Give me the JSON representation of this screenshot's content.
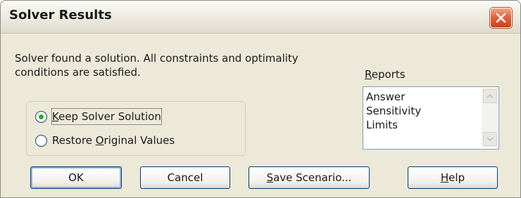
{
  "window": {
    "title": "Solver Results"
  },
  "message": {
    "line1": "Solver found a solution.  All constraints and optimality",
    "line2": "conditions are satisfied."
  },
  "reports": {
    "label_underlined": "R",
    "label_rest": "eports",
    "items": [
      "Answer",
      "Sensitivity",
      "Limits"
    ]
  },
  "options": {
    "keep": {
      "underlined": "K",
      "rest": "eep Solver Solution",
      "selected": true
    },
    "restore": {
      "pre": "Restore ",
      "underlined": "O",
      "rest": "riginal Values",
      "selected": false
    }
  },
  "buttons": {
    "ok": "OK",
    "cancel": "Cancel",
    "save_underlined": "S",
    "save_rest": "ave Scenario...",
    "help_underlined": "H",
    "help_rest": "elp"
  },
  "icons": {
    "close": "close-icon",
    "scroll_up": "scroll-up-icon",
    "scroll_down": "scroll-down-icon"
  },
  "colors": {
    "dialog_bg": "#ece9d8",
    "close_red": "#e0643e",
    "radio_selected": "#2fa52f",
    "button_border": "#003c74"
  }
}
